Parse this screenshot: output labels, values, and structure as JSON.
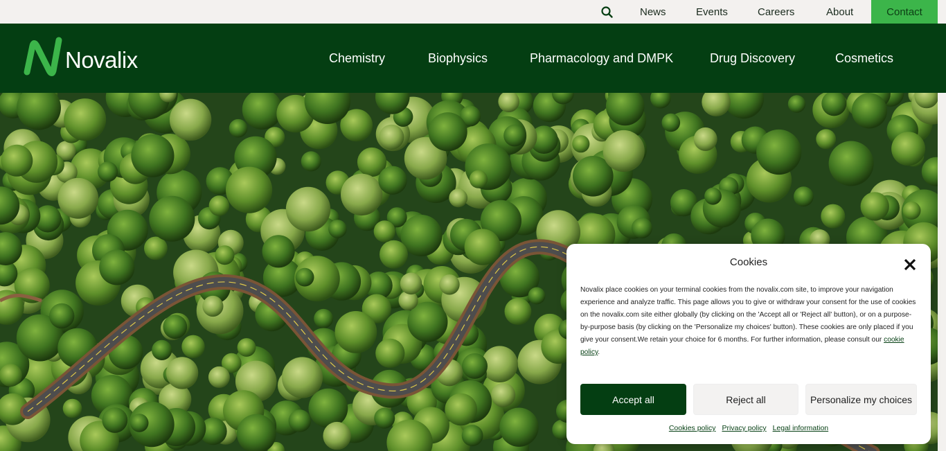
{
  "topbar": {
    "search_icon": "search-icon",
    "links": [
      "News",
      "Events",
      "Careers",
      "About"
    ],
    "contact": "Contact"
  },
  "header": {
    "logo_text": "Novalix",
    "nav": [
      "Chemistry",
      "Biophysics",
      "Pharmacology and DMPK",
      "Drug Discovery",
      "Cosmetics"
    ]
  },
  "cookie_banner": {
    "title": "Cookies",
    "close_icon": "close-icon",
    "text": "Novalix place cookies on your terminal cookies from the novalix.com site, to improve your navigation experience and analyze traffic. This page allows you to give or withdraw your consent for the use of cookies on the novalix.com site either globally (by clicking on the 'Accept all or 'Reject all' button), or on a purpose-by-purpose basis (by clicking on the 'Personalize my choices' button). These cookies are only placed if you give your consent.We retain your choice for 6 months. For further information, please consult our ",
    "policy_link": "cookie policy",
    "text_end": ".",
    "accept": "Accept all",
    "reject": "Reject all",
    "personalize": "Personalize my choices",
    "footer_links": [
      "Cookies policy",
      "Privacy policy",
      "Legal information"
    ]
  },
  "colors": {
    "brand_dark_green": "#043e12",
    "brand_light_green": "#3cb54a",
    "topbar_bg": "#f3f1ef"
  }
}
